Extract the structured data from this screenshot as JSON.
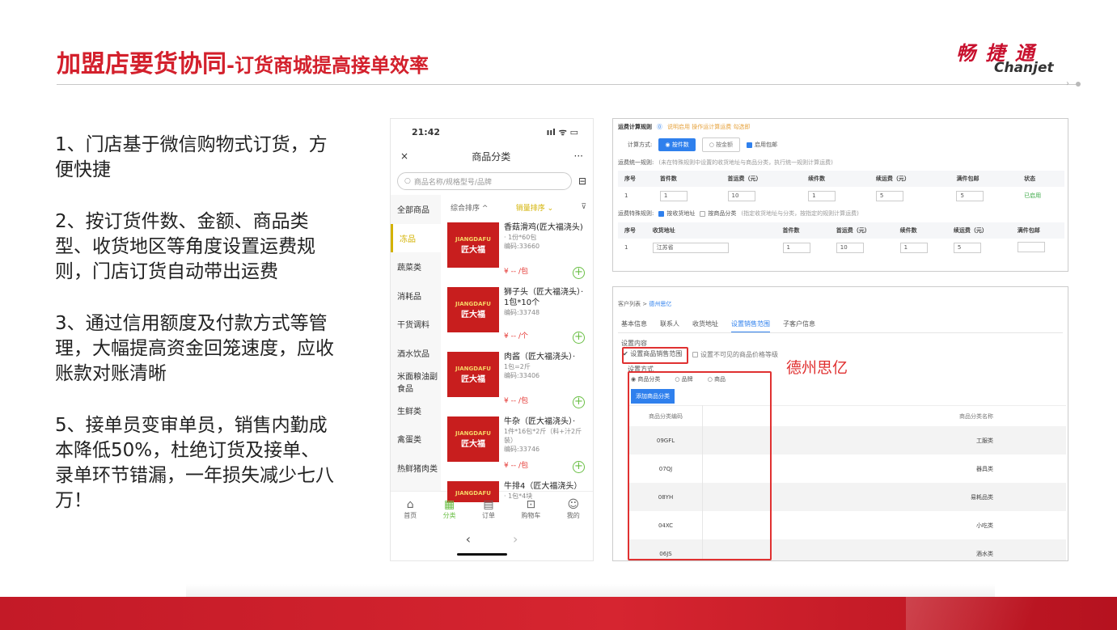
{
  "header": {
    "title_main": "加盟店要货协同",
    "title_sub": "-订货商城提高接单效率",
    "logo_cn": "畅 捷 通",
    "logo_en": "Chanjet"
  },
  "points": [
    "1、门店基于微信购物式订货，方便快捷",
    "2、按订货件数、金额、商品类型、收货地区等角度设置运费规则，门店订货自动带出运费",
    "3、通过信用额度及付款方式等管理，大幅提高资金回笼速度，应收账款对账清晰",
    "5、接单员变审单员，销售内勤成本降低50%，杜绝订货及接单、录单环节错漏，一年损失减少七八万！"
  ],
  "phone": {
    "time": "21:42",
    "status_icons": "ııl ᯤ ▭",
    "close": "×",
    "page_title": "商品分类",
    "more": "···",
    "search_placeholder": "商品名称/规格型号/品牌",
    "scan": "⊟",
    "categories": [
      "全部商品",
      "冻品",
      "蔬菜类",
      "消耗品",
      "干货调料",
      "酒水饮品",
      "米面粮油副食品",
      "生鲜类",
      "禽蛋类",
      "热鲜猪肉类"
    ],
    "sort": {
      "combined": "综合排序 ^",
      "sales": "销量排序 ⌄",
      "filter": "⊽"
    },
    "items": [
      {
        "name": "香菇滑鸡(匠大福浇头)",
        "spec": "· 1份*60包",
        "code": "编码:33660",
        "price": "¥ -- /包"
      },
      {
        "name": "狮子头（匠大福浇头）· 1包*10个",
        "spec": "",
        "code": "编码:33748",
        "price": "¥ -- /个"
      },
      {
        "name": "肉酱（匠大福浇头）·",
        "spec": "1包=2斤",
        "code": "编码:33406",
        "price": "¥ -- /包"
      },
      {
        "name": "牛杂（匠大福浇头）·",
        "spec": "1件*16包*2斤（料+汁2斤装）",
        "code": "编码:33746",
        "price": "¥ -- /包"
      },
      {
        "name": "牛排4（匠大福浇头）",
        "spec": "· 1包*4块",
        "code": "",
        "price": ""
      }
    ],
    "brand_small": "JIANGDAFU",
    "brand_big": "匠大福",
    "plus": "+",
    "tabs": [
      {
        "icon": "⌂",
        "label": "首页"
      },
      {
        "icon": "▦",
        "label": "分类"
      },
      {
        "icon": "▤",
        "label": "订单"
      },
      {
        "icon": "⊡",
        "label": "购物车"
      },
      {
        "icon": "☺",
        "label": "我的"
      }
    ],
    "nav_back": "‹",
    "nav_fwd": "›"
  },
  "freight": {
    "title": "运费计算规则",
    "help": "⓪",
    "toolbar_note": "说明启用 操作运计算运费 勾选即",
    "mode_label": "计算方式:",
    "mode_on": "◉ 按件数",
    "mode_off": "○ 按金额",
    "credit": "启用包邮",
    "general_label": "运费统一规则:",
    "general_note": "(未在特殊规则中设置的收货地址与商品分类，执行统一规则计算运费)",
    "t1_headers": [
      "序号",
      "首件数",
      "首运费（元）",
      "续件数",
      "续运费（元）",
      "满件包邮",
      "状态"
    ],
    "t1_row": [
      "1",
      "1",
      "10",
      "1",
      "5",
      "5",
      "已启用"
    ],
    "special_label": "运费特殊规则:",
    "special_opt1": "按收货地址",
    "special_opt2": "按商品分类",
    "special_note": "(指定收货地址与分类，按指定的规则计算运费)",
    "t2_headers": [
      "序号",
      "收货地址",
      "首件数",
      "首运费（元）",
      "续件数",
      "续运费（元）",
      "满件包邮"
    ],
    "t2_row": [
      "1",
      "江苏省",
      "1",
      "10",
      "1",
      "5",
      ""
    ]
  },
  "customer": {
    "breadcrumb_a": "客户列表 > ",
    "breadcrumb_b": "德州思亿",
    "tabs": [
      "基本信息",
      "联系人",
      "收货地址",
      "设置销售范围",
      "子客户信息"
    ],
    "setting_label": "设置内容",
    "check1": "✔ 设置商品销售范围",
    "check2": "设置不可见的商品价格等级",
    "range_label": "设置方式",
    "radios": [
      "◉ 商品分类",
      "○ 品牌",
      "○ 商品"
    ],
    "add_button": "添加商品分类",
    "col1": "商品分类编码",
    "col2": "商品分类名称",
    "rows": [
      {
        "code": "09GFL",
        "name": "工服类"
      },
      {
        "code": "07QJ",
        "name": "器具类"
      },
      {
        "code": "08YH",
        "name": "易耗品类"
      },
      {
        "code": "04XC",
        "name": "小吃类"
      },
      {
        "code": "06JS",
        "name": "酒水类"
      }
    ]
  },
  "annotation": "德州思亿",
  "colors": {
    "brand_red": "#d3202c",
    "accent_blue": "#2f80ed",
    "highlight_red": "#e03131"
  }
}
